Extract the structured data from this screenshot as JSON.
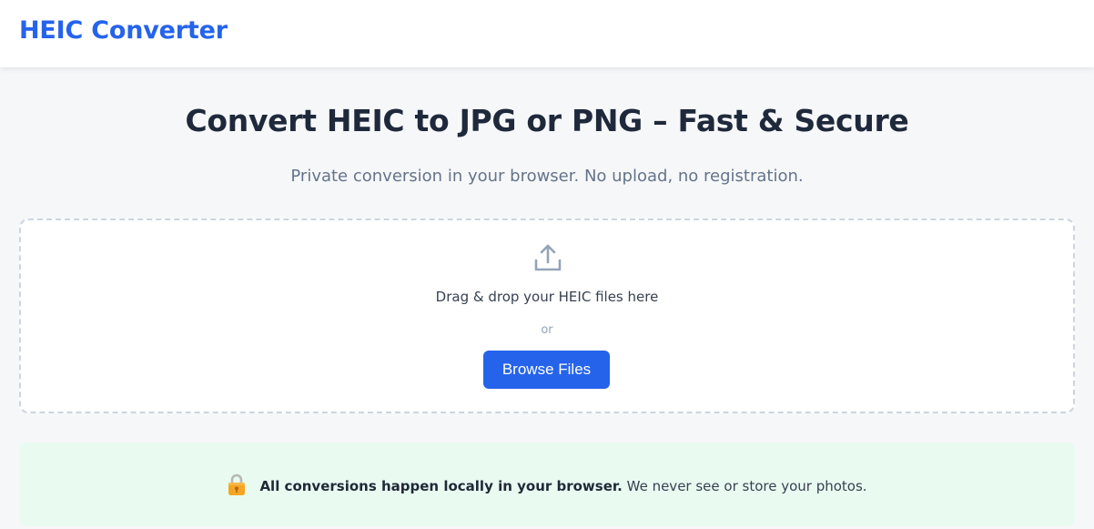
{
  "header": {
    "brand": "HEIC Converter"
  },
  "hero": {
    "title": "Convert HEIC to JPG or PNG – Fast & Secure",
    "subtitle": "Private conversion in your browser. No upload, no registration."
  },
  "dropzone": {
    "icon": "upload-icon",
    "instruction": "Drag & drop your HEIC files here",
    "separator": "or",
    "browse_label": "Browse Files"
  },
  "notice": {
    "icon": "lock-icon",
    "strong": "All conversions happen locally in your browser.",
    "text": " We never see or store your photos."
  },
  "colors": {
    "accent": "#2563eb",
    "notice_bg": "#e9fbf1",
    "page_bg": "#f6f7f9"
  }
}
